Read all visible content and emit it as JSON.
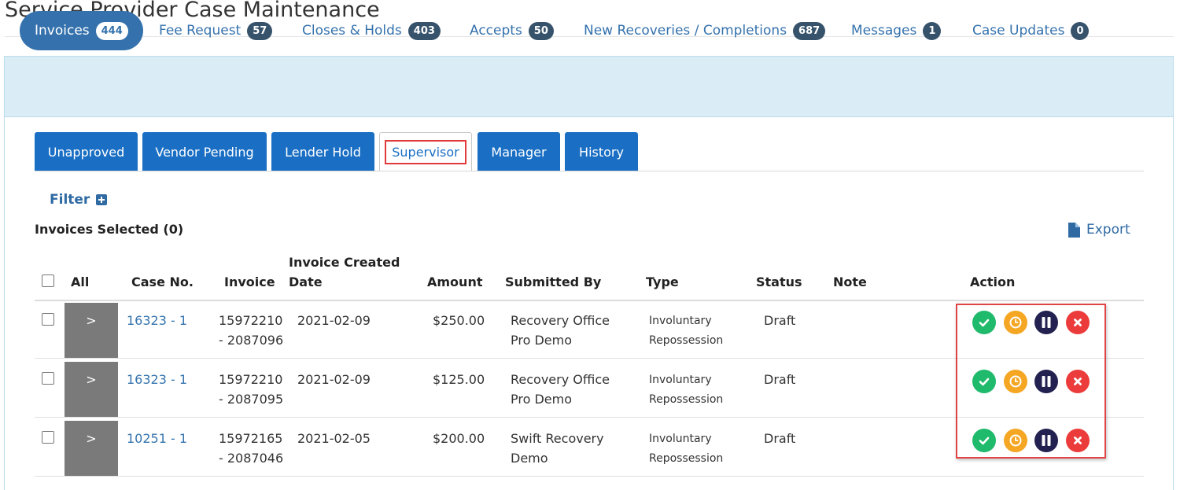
{
  "page": {
    "title": "Service Provider Case Maintenance"
  },
  "main_tabs": [
    {
      "label": "Invoices",
      "count": "444"
    },
    {
      "label": "Fee Request",
      "count": "57"
    },
    {
      "label": "Closes & Holds",
      "count": "403"
    },
    {
      "label": "Accepts",
      "count": "50"
    },
    {
      "label": "New Recoveries / Completions",
      "count": "687"
    },
    {
      "label": "Messages",
      "count": "1"
    },
    {
      "label": "Case Updates",
      "count": "0"
    }
  ],
  "sub_tabs": [
    "Unapproved",
    "Vendor Pending",
    "Lender Hold",
    "Supervisor",
    "Manager",
    "History"
  ],
  "filter": {
    "label": "Filter"
  },
  "selection": {
    "label": "Invoices Selected (0)"
  },
  "export": {
    "label": "Export"
  },
  "table": {
    "headers": {
      "all": "All",
      "case_no": "Case No.",
      "invoice": "Invoice",
      "created_line1": "Invoice Created",
      "created_line2": "Date",
      "amount": "Amount",
      "submitted_by": "Submitted By",
      "type": "Type",
      "status": "Status",
      "note": "Note",
      "action": "Action"
    },
    "rows": [
      {
        "case_no": "16323 - 1",
        "invoice_l1": "15972210",
        "invoice_l2": "- 2087096",
        "date": "2021-02-09",
        "amount": "$250.00",
        "submitted_l1": "Recovery Office",
        "submitted_l2": "Pro Demo",
        "type_l1": "Involuntary",
        "type_l2": "Repossession",
        "status": "Draft",
        "note": ""
      },
      {
        "case_no": "16323 - 1",
        "invoice_l1": "15972210",
        "invoice_l2": "- 2087095",
        "date": "2021-02-09",
        "amount": "$125.00",
        "submitted_l1": "Recovery Office",
        "submitted_l2": "Pro Demo",
        "type_l1": "Involuntary",
        "type_l2": "Repossession",
        "status": "Draft",
        "note": ""
      },
      {
        "case_no": "10251 - 1",
        "invoice_l1": "15972165",
        "invoice_l2": "- 2087046",
        "date": "2021-02-05",
        "amount": "$200.00",
        "submitted_l1": "Swift Recovery",
        "submitted_l2": "Demo",
        "type_l1": "Involuntary",
        "type_l2": "Repossession",
        "status": "Draft",
        "note": ""
      }
    ]
  },
  "expander_glyph": ">",
  "colors": {
    "approve": "#1fba6b",
    "hold": "#f5a623",
    "pause": "#23214f",
    "reject": "#ec3b3b",
    "highlight": "#e03a3a"
  }
}
